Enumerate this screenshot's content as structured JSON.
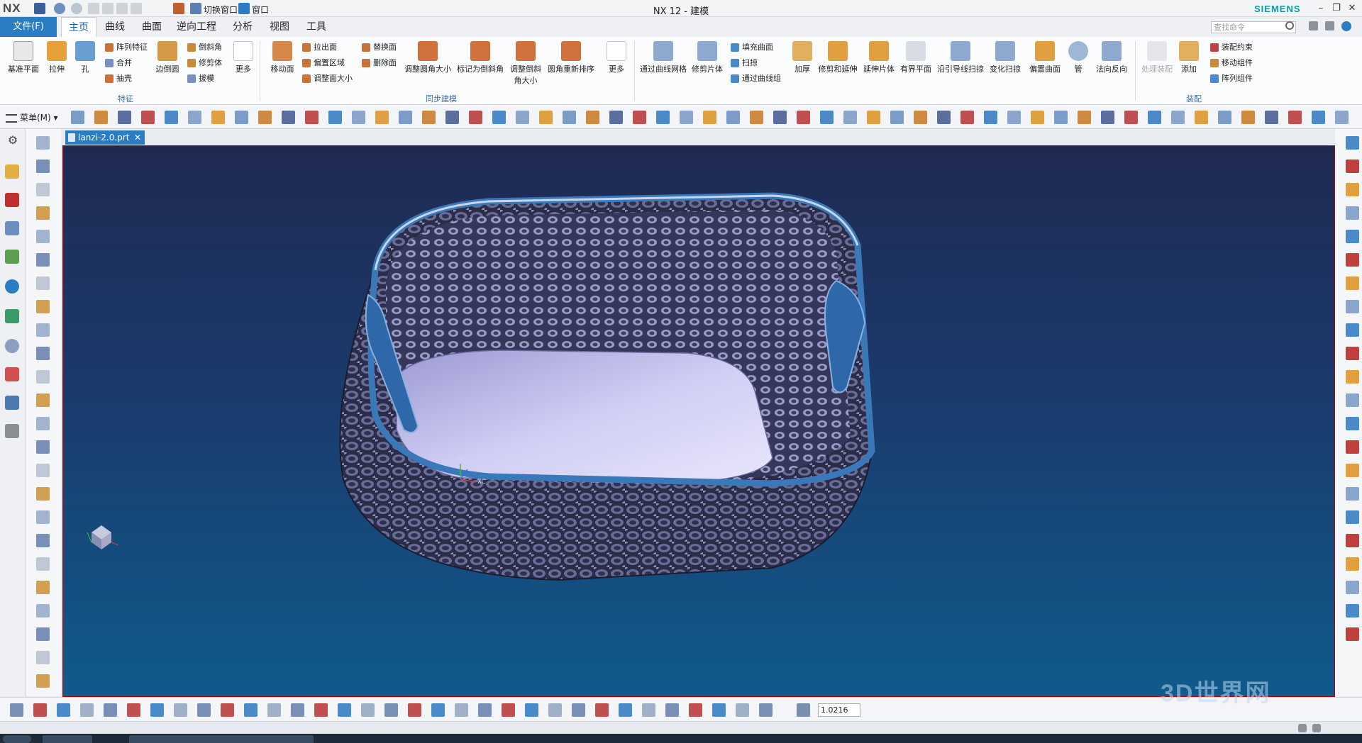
{
  "app": {
    "logo": "NX",
    "title": "NX 12 - 建模",
    "brand": "SIEMENS",
    "switch_window": "切换窗口",
    "window_menu": "窗口"
  },
  "tabs": {
    "file": "文件(F)",
    "items": [
      "主页",
      "曲线",
      "曲面",
      "逆向工程",
      "分析",
      "视图",
      "工具"
    ],
    "active": "主页",
    "search_placeholder": "查找命令"
  },
  "ribbon": {
    "feature": {
      "label": "特征",
      "big": [
        "基准平面",
        "拉伸",
        "孔",
        "边倒圆",
        "更多"
      ],
      "small": [
        "阵列特征",
        "合并",
        "抽壳",
        "倒斜角",
        "修剪体",
        "拔模"
      ]
    },
    "sync": {
      "label": "同步建模",
      "big": [
        "移动面",
        "调整圆角大小",
        "标记为倒斜角",
        "调整倒斜角大小",
        "圆角重新排序",
        "更多"
      ],
      "small": [
        "拉出面",
        "偏置区域",
        "调整面大小",
        "替换面",
        "删除面"
      ]
    },
    "surface": {
      "big": [
        "通过曲线网格",
        "修剪片体",
        "加厚",
        "修剪和延伸",
        "延伸片体",
        "有界平面",
        "沿引导线扫掠",
        "变化扫掠",
        "偏置曲面",
        "管",
        "法向反向"
      ],
      "small": [
        "填充曲面",
        "扫掠",
        "通过曲线组"
      ]
    },
    "assembly": {
      "label": "装配",
      "big": [
        "处理装配",
        "添加"
      ],
      "small": [
        "装配约束",
        "移动组件",
        "阵列组件"
      ]
    }
  },
  "commandbar": {
    "menu_label": "菜单(M)"
  },
  "document": {
    "tab_name": "lanzi-2.0.prt",
    "triad_labels": [
      "YC",
      "ZC",
      "XC"
    ]
  },
  "bottombar": {
    "scale_value": "1.0216"
  },
  "watermark": "3D世界网",
  "colors": {
    "accent": "#2a7dc2",
    "brand": "#0a9aa8",
    "viewport_top": "#1f2a52",
    "viewport_bottom": "#0f5b8c",
    "model_mesh": "#5a5c88",
    "model_floor": "#c9c8f0",
    "rim": "#3a78b8"
  }
}
